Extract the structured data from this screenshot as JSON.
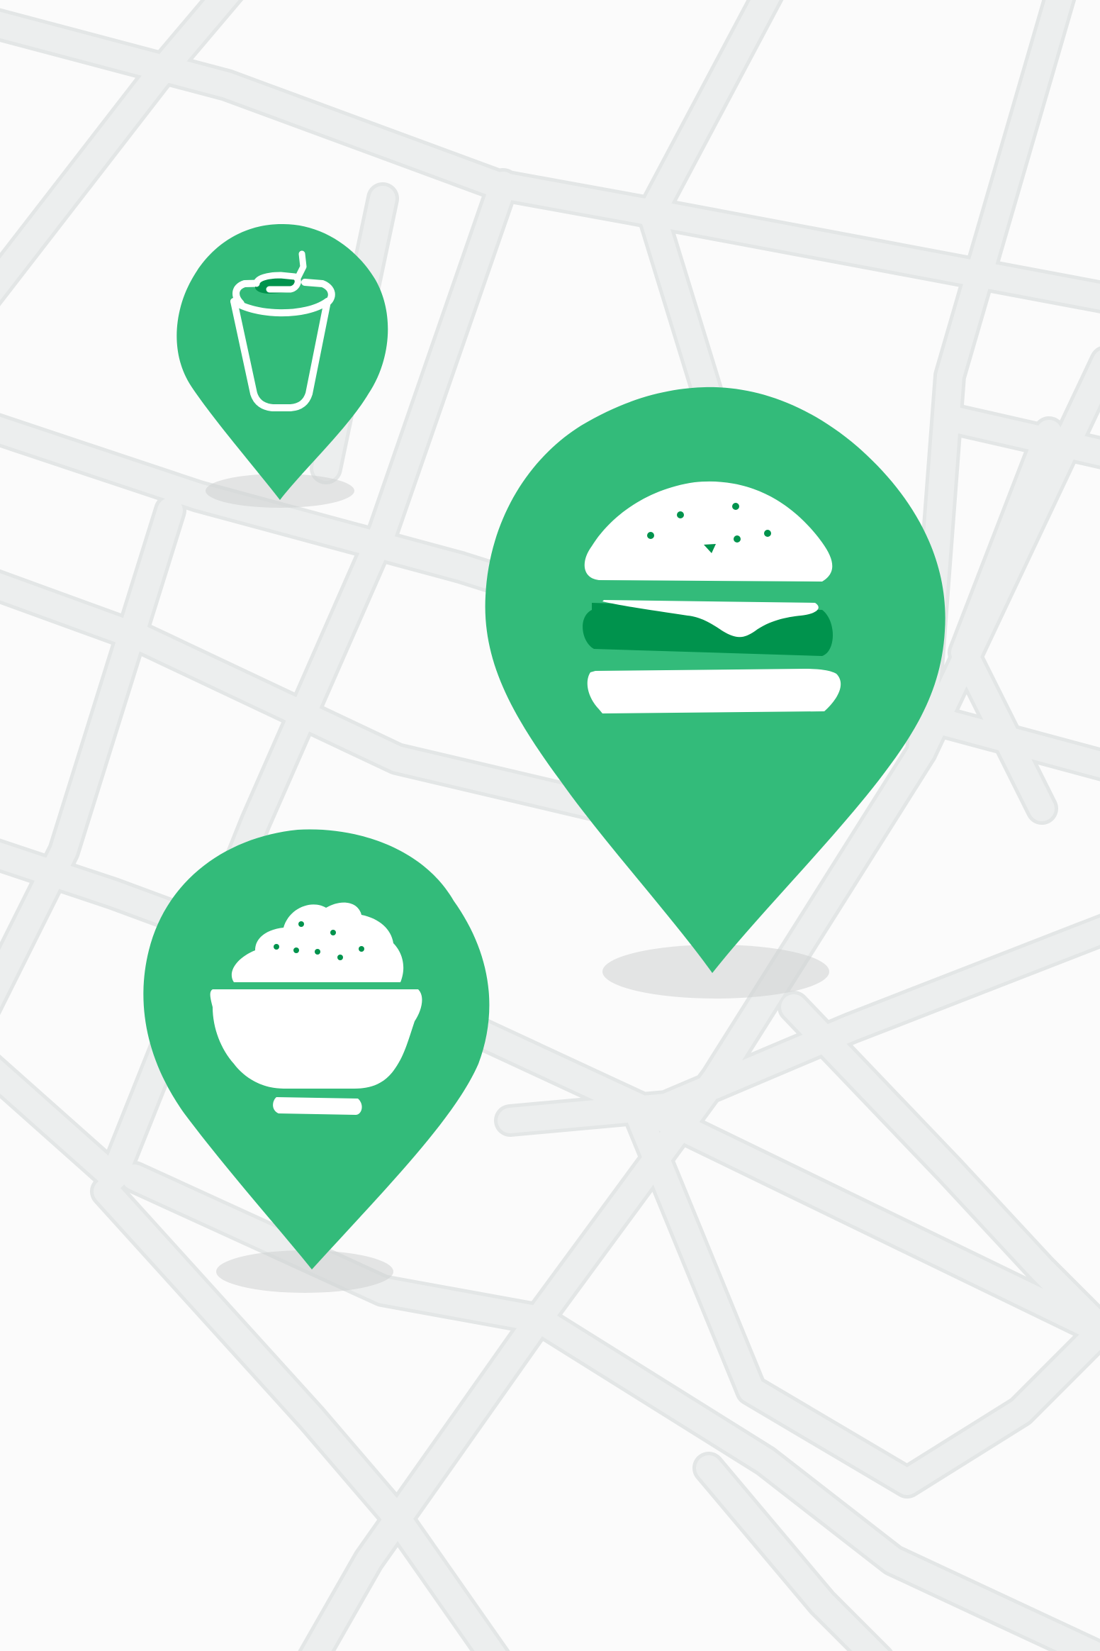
{
  "map": {
    "theme_colors": {
      "background": "#fbfbfb",
      "road": "#eceeee",
      "pin": "#33bb7a",
      "pin_accent": "#00934d",
      "icon": "#ffffff"
    }
  },
  "markers": [
    {
      "id": "drink",
      "icon": "drink-cup-icon"
    },
    {
      "id": "burger",
      "icon": "burger-icon",
      "selected": true
    },
    {
      "id": "rice",
      "icon": "rice-bowl-icon"
    }
  ]
}
